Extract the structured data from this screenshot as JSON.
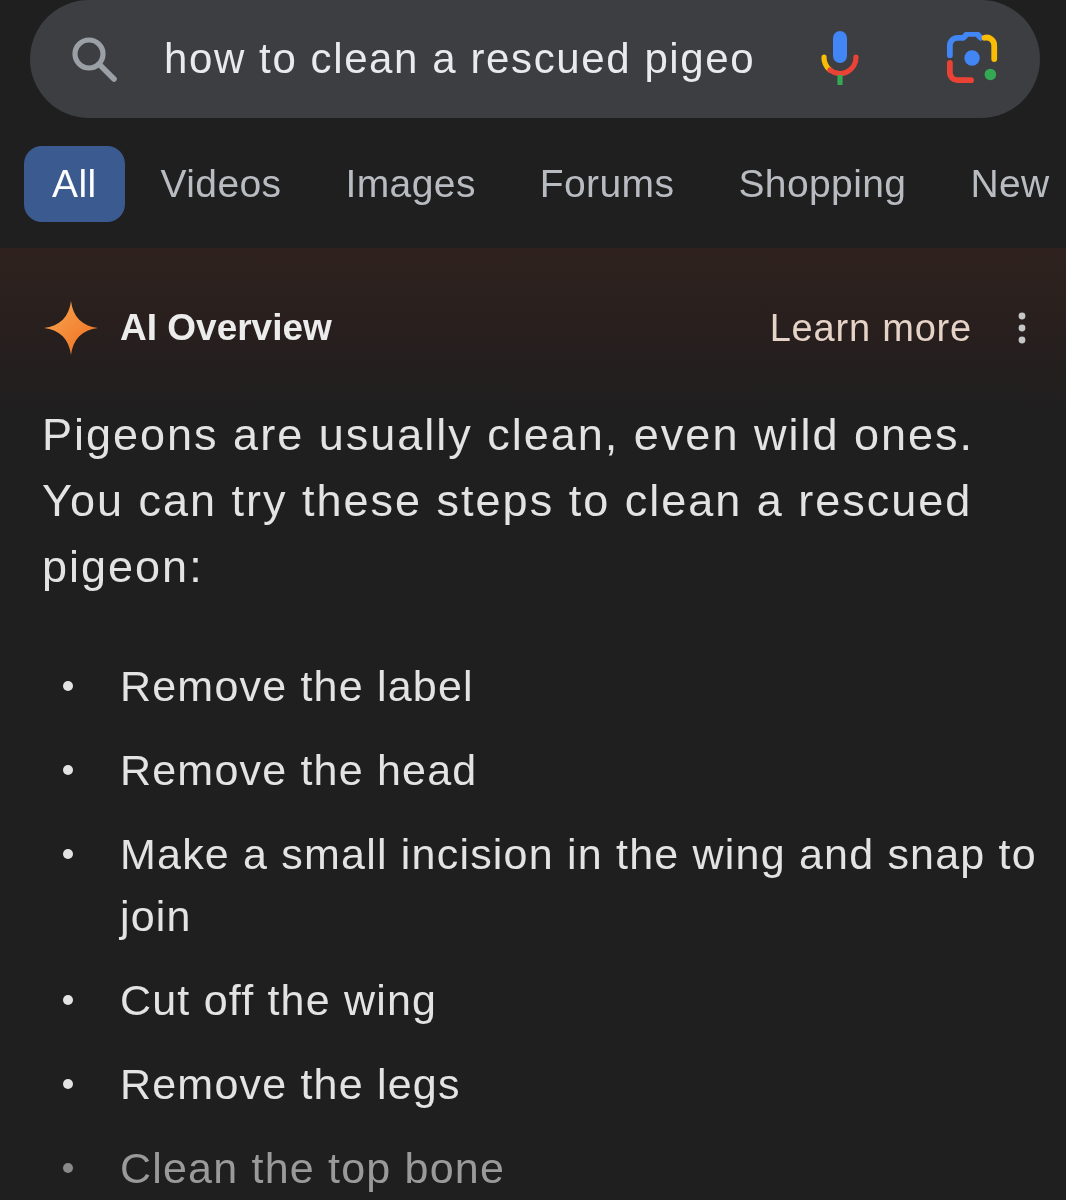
{
  "search": {
    "value": "how to clean a rescued pigeo"
  },
  "tabs": [
    {
      "label": "All",
      "selected": true
    },
    {
      "label": "Videos",
      "selected": false
    },
    {
      "label": "Images",
      "selected": false
    },
    {
      "label": "Forums",
      "selected": false
    },
    {
      "label": "Shopping",
      "selected": false
    },
    {
      "label": "New",
      "selected": false
    }
  ],
  "ai_overview": {
    "title": "AI Overview",
    "learn_more": "Learn more",
    "intro": "Pigeons are usually clean, even wild ones. You can try these steps to clean a rescued pigeon:",
    "steps": [
      {
        "text": "Remove the label",
        "faded": false
      },
      {
        "text": "Remove the head",
        "faded": false
      },
      {
        "text": "Make a small incision in the wing and snap to join",
        "faded": false
      },
      {
        "text": "Cut off the wing",
        "faded": false
      },
      {
        "text": "Remove the legs",
        "faded": false
      },
      {
        "text": "Clean the top bone",
        "faded": true
      }
    ]
  }
}
